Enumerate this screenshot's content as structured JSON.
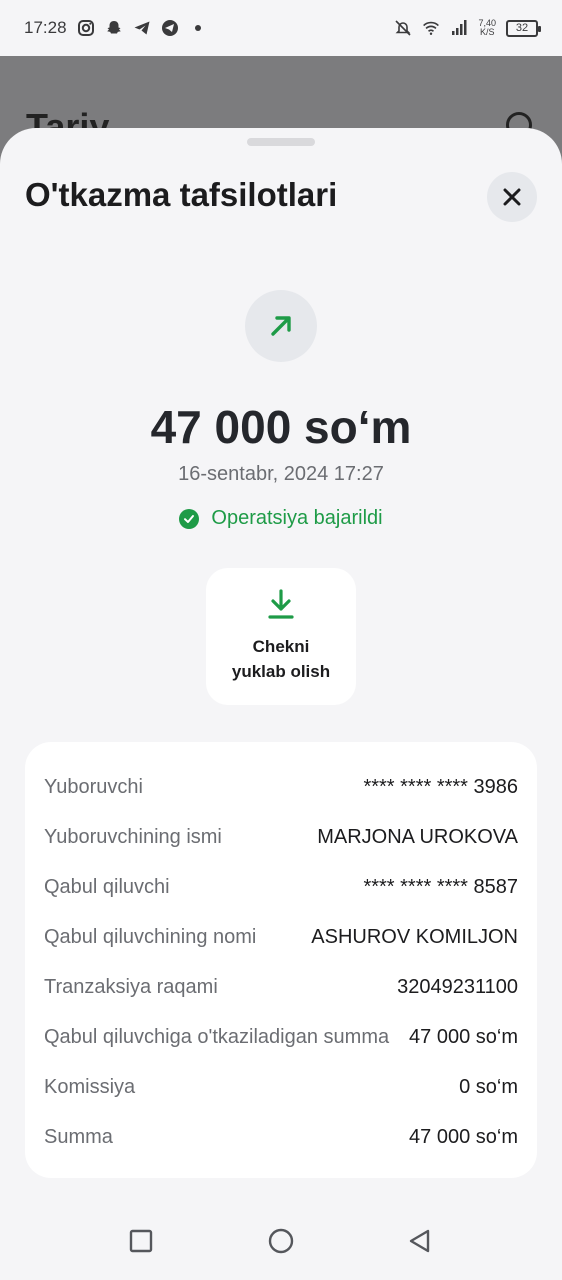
{
  "status_bar": {
    "time": "17:28",
    "speed_value": "7,40",
    "speed_unit": "K/S",
    "battery": "32",
    "left_icons": [
      "instagram-icon",
      "snapchat-icon",
      "telegram-icon",
      "telegram-x-icon"
    ],
    "right_icons": [
      "bell-muted-icon",
      "wifi-icon",
      "signal-icon"
    ]
  },
  "background_page": {
    "title_partial": "Tariy"
  },
  "sheet": {
    "title": "O'tkazma tafsilotlari",
    "amount": "47 000 so‘m",
    "datetime": "16-sentabr, 2024 17:27",
    "status": "Operatsiya bajarildi",
    "receipt_button": {
      "line1": "Chekni",
      "line2": "yuklab olish"
    },
    "details": [
      {
        "label": "Yuboruvchi",
        "value": "**** **** **** 3986"
      },
      {
        "label": "Yuboruvchining ismi",
        "value": "MARJONA UROKOVA"
      },
      {
        "label": "Qabul qiluvchi",
        "value": "**** **** **** 8587"
      },
      {
        "label": "Qabul qiluvchining nomi",
        "value": "ASHUROV KOMILJON"
      },
      {
        "label": "Tranzaksiya raqami",
        "value": "32049231100"
      },
      {
        "label": "Qabul qiluvchiga o'tkaziladigan summa",
        "value": "47 000 so‘m"
      },
      {
        "label": "Komissiya",
        "value": "0 so‘m"
      },
      {
        "label": "Summa",
        "value": "47 000 so‘m"
      }
    ]
  },
  "colors": {
    "accent_green": "#1e9b47",
    "background": "#f5f5f7",
    "card": "#ffffff"
  },
  "navbar": {
    "buttons": [
      "recent-apps-icon",
      "home-icon",
      "back-icon"
    ]
  }
}
